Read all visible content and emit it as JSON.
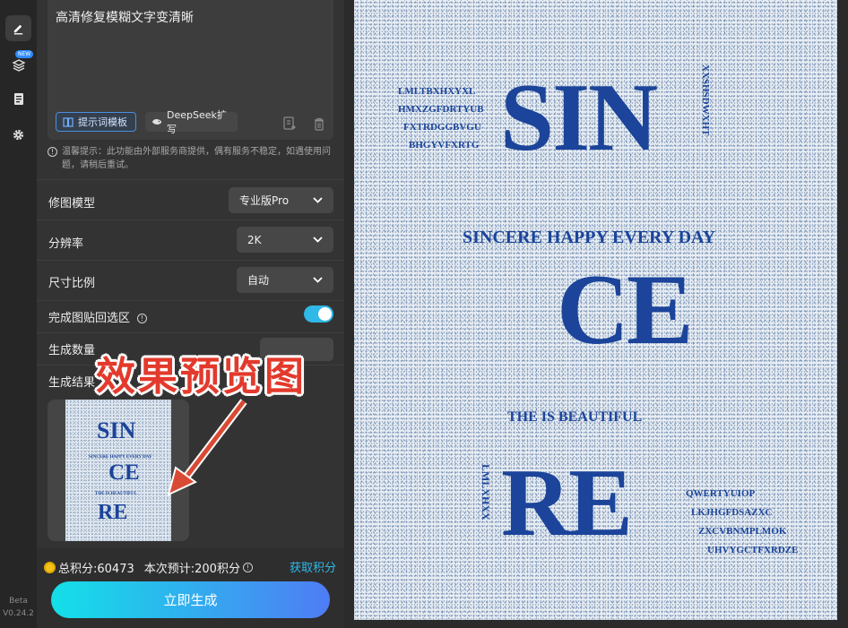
{
  "sidebar_rail": {
    "icons": [
      "pencil-icon",
      "layers-icon",
      "document-icon",
      "gear-icon"
    ],
    "new_badge": "NEW",
    "version_line1": "Beta",
    "version_line2": "V0.24.2"
  },
  "prompt": {
    "text": "高清修复模糊文字变清晰",
    "template_button": "提示词模板",
    "deepseek_button": "DeepSeek扩写"
  },
  "notice": "温馨提示：此功能由外部服务商提供，偶有服务不稳定，如遇使用问题，请稍后重试。",
  "settings": {
    "model_label": "修图模型",
    "model_value": "专业版Pro",
    "resolution_label": "分辨率",
    "resolution_value": "2K",
    "ratio_label": "尺寸比例",
    "ratio_value": "自动",
    "paste_label": "完成图贴回选区",
    "paste_on": true,
    "count_label": "生成数量",
    "result_label": "生成结果"
  },
  "overlay_caption": "效果预览图",
  "footer": {
    "points_label": "总积分:60473",
    "estimate_label": "本次预计:200积分",
    "get_points": "获取积分",
    "generate_button": "立即生成"
  },
  "preview": {
    "big_sin": "SIN",
    "big_ce": "CE",
    "big_re": "RE",
    "left_lines": [
      "LMLTBXHXYXL",
      "HMXZGFDRTYUB",
      "FXTRDGGBVGU",
      "BHGYVFXRTG"
    ],
    "vertical_right": "XXSHSDWXHT",
    "tagline": "SINCERE  HAPPY  EVERY  DAY",
    "beautiful": "THE  IS  BEAUTIFUL",
    "vertical_left": "LMLXHXX",
    "right_lines": [
      "QWERTYUIOP",
      "LKJHGFDSAZXC",
      "ZXCVBNMPLMOK",
      "UHVYGCTFXRDZE"
    ]
  },
  "colors": {
    "accent_blue": "#1b449a",
    "toggle": "#2fb8e8",
    "button_gradient_start": "#13e0e8",
    "button_gradient_end": "#4f7cf5",
    "get_points": "#2fb8e8",
    "overlay_red": "#e23a2c"
  }
}
